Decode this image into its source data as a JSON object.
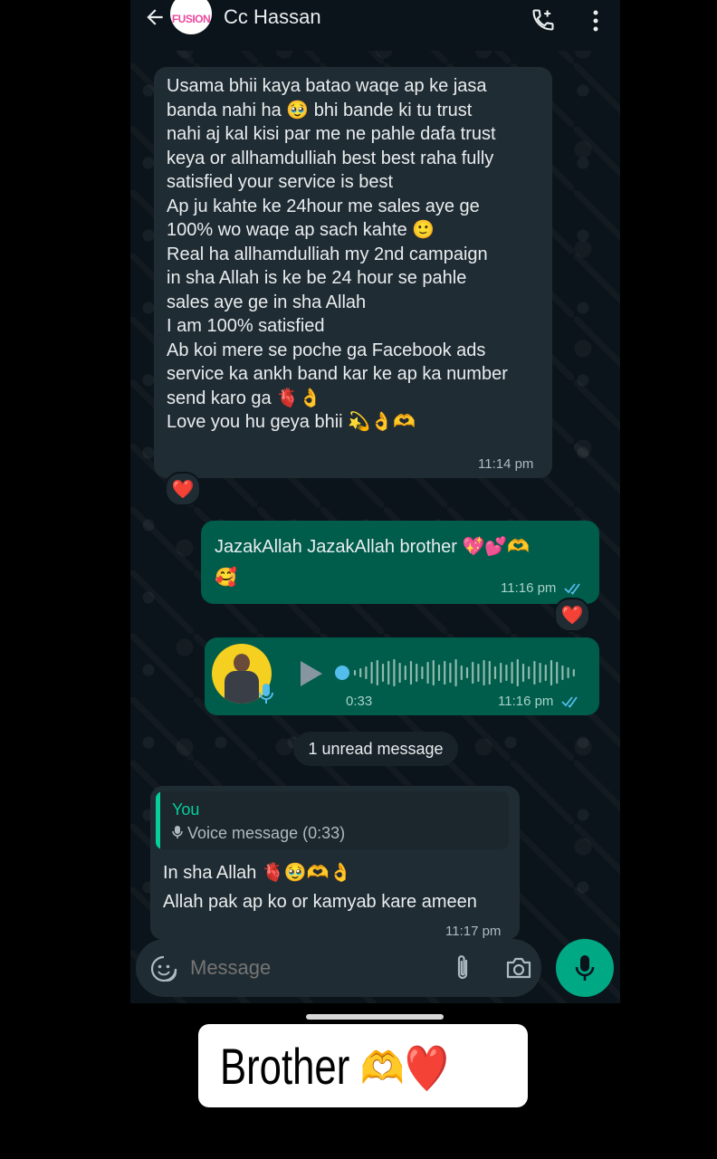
{
  "header": {
    "contact_name": "Cc Hassan",
    "avatar_logo_text": "FUSION"
  },
  "messages": [
    {
      "direction": "incoming",
      "text": "Usama bhii kaya batao waqe ap ke jasa\nbanda nahi ha 🥹 bhi bande ki tu trust\nnahi aj kal kisi par me ne pahle dafa trust\nkeya or allhamdulliah best best raha fully\nsatisfied your service is best\nAp ju kahte ke 24hour me sales aye ge\n100% wo waqe ap sach kahte 🙂\nReal ha allhamdulliah my 2nd campaign\nin sha Allah is ke be 24 hour se pahle\nsales aye ge in sha Allah\nI am 100% satisfied\nAb koi mere se poche ga Facebook ads\nservice ka ankh band kar ke ap ka number\nsend karo ga 🫀👌\nLove you hu geya bhii 💫👌🫶",
      "time": "11:14 pm",
      "reaction": "❤️"
    },
    {
      "direction": "outgoing",
      "text": "JazakAllah JazakAllah brother 💖💕🫶\n🥰",
      "time": "11:16 pm",
      "reaction": "❤️"
    },
    {
      "direction": "outgoing",
      "type": "voice",
      "duration": "0:33",
      "time": "11:16 pm",
      "progress": 0
    },
    {
      "direction": "incoming",
      "quote_author": "You",
      "quote_text": "Voice message (0:33)",
      "text": "In sha Allah 🫀🥹🫶👌\nAllah pak ap ko or kamyab kare ameen",
      "time": "11:17 pm"
    }
  ],
  "unread_label": "1 unread message",
  "input": {
    "placeholder": "Message"
  },
  "caption": {
    "text": "Brother",
    "emoji": "🫶❤️"
  },
  "colors": {
    "incoming_bubble": "#202c33",
    "outgoing_bubble": "#005c4b",
    "accent_green": "#00a884",
    "read_ticks": "#53bdeb"
  },
  "icons": [
    "back-arrow-icon",
    "call-add-icon",
    "more-vertical-icon",
    "sticker-icon",
    "attach-icon",
    "camera-icon",
    "mic-icon",
    "play-icon",
    "check-double-icon"
  ]
}
